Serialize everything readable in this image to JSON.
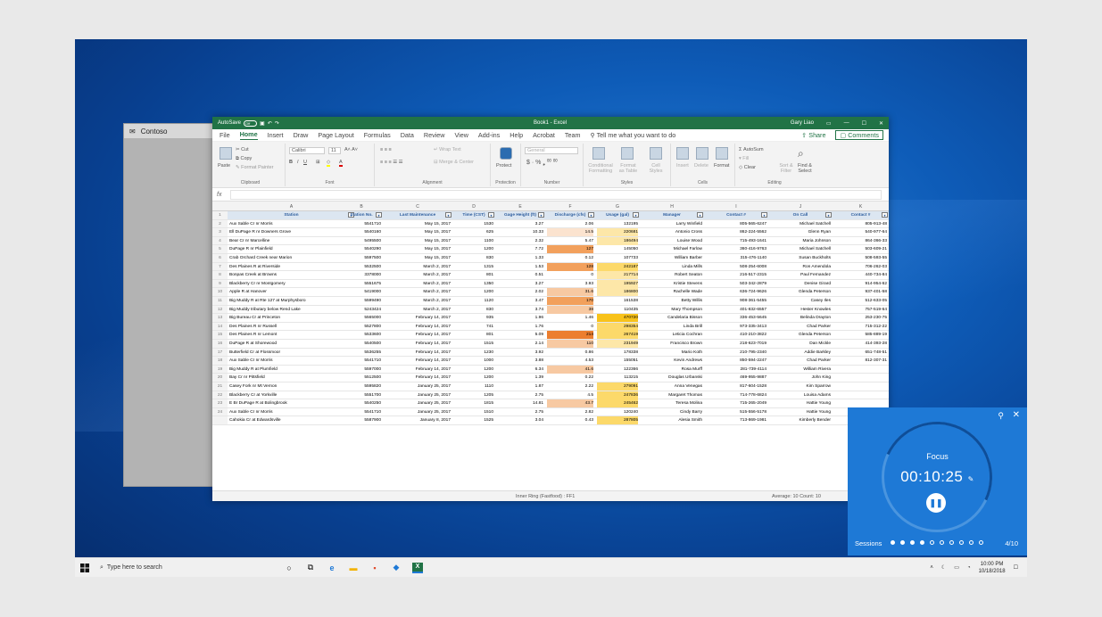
{
  "excel": {
    "autosave": "AutoSave",
    "autosave_state": "Off",
    "title": "Book1 - Excel",
    "user": "Gary Liao",
    "menu": [
      "File",
      "Home",
      "Insert",
      "Draw",
      "Page Layout",
      "Formulas",
      "Data",
      "Review",
      "View",
      "Add-ins",
      "Help",
      "Acrobat",
      "Team"
    ],
    "tell_me": "Tell me what you want to do",
    "share": "Share",
    "comments": "Comments",
    "ribbon": {
      "cut": "Cut",
      "copy": "Copy",
      "format_painter": "Format Painter",
      "paste": "Paste",
      "clipboard": "Clipboard",
      "font_name": "Calibri",
      "font_size": "11",
      "font": "Font",
      "wrap": "Wrap Text",
      "merge": "Merge & Center",
      "alignment": "Alignment",
      "protect": "Protect",
      "protection": "Protection",
      "number_format": "General",
      "number": "Number",
      "cond": "Conditional Formatting",
      "format_table": "Format as Table",
      "cell_styles": "Cell Styles",
      "styles": "Styles",
      "insert": "Insert",
      "delete": "Delete",
      "format": "Format",
      "cells": "Cells",
      "autosum": "AutoSum",
      "fill": "Fill",
      "clear": "Clear",
      "sort": "Sort & Filter",
      "find": "Find & Select",
      "editing": "Editing"
    },
    "fx": "fx",
    "columns": [
      "A",
      "B",
      "C",
      "D",
      "E",
      "F",
      "G",
      "H",
      "I",
      "J",
      "K"
    ],
    "headers": [
      "Station",
      "Station No.",
      "Last Maintenance",
      "Time (CST)",
      "Gage Height (ft)",
      "Discharge (cfs)",
      "Usage (gal)",
      "Manager",
      "Contact #",
      "On Call",
      "Contact #"
    ],
    "rows": [
      [
        "Aux Sable Cr nr Morris",
        "5541710",
        "May 15, 2017",
        "1530",
        "3.27",
        "2.06",
        "132195",
        "Larry Winfield",
        "805-565-6247",
        "Michael Satchell",
        "805-913-48"
      ],
      [
        "Ell DuPage R nr Downers Grove",
        "5540160",
        "May 15, 2017",
        "625",
        "10.33",
        "14.5",
        "220681",
        "Antonio Cross",
        "862-224-5562",
        "Glenn Ryan",
        "540-977-64"
      ],
      [
        "Bear Cr nr Marcelline",
        "5495500",
        "May 15, 2017",
        "1100",
        "2.32",
        "5.47",
        "186494",
        "Louise Wood",
        "715-493-1641",
        "Maria Johnson",
        "864-366-33"
      ],
      [
        "DuPage R nr Plainfield",
        "5540290",
        "May 15, 2017",
        "1200",
        "7.72",
        "127",
        "145050",
        "Michael Farlow",
        "360-416-9763",
        "Michael Satchell",
        "503-609-21"
      ],
      [
        "Crab Orchard Creek near Marion",
        "5597500",
        "May 15, 2017",
        "830",
        "1.33",
        "0.12",
        "107733",
        "William Barber",
        "315-476-1140",
        "Susan Buckholts",
        "508-593-55"
      ],
      [
        "Des Plaines R at Riverside",
        "5532500",
        "March 2, 2017",
        "1315",
        "1.53",
        "128",
        "242187",
        "Linda Mills",
        "508-254-6008",
        "Ron Amendola",
        "706-262-03"
      ],
      [
        "Bonpas Creek at Browns",
        "3378000",
        "March 2, 2017",
        "801",
        "0.51",
        "0",
        "217714",
        "Robert Seaton",
        "216-517-2315",
        "Paul Fernandez",
        "440-734-84"
      ],
      [
        "Blackberry Cr nr Montgomery",
        "5551675",
        "March 2, 2017",
        "1350",
        "3.27",
        "3.93",
        "195927",
        "Kristie Stevens",
        "503-342-2879",
        "Denise Girard",
        "914-954-62"
      ],
      [
        "Apple R at Hanover",
        "5419000",
        "March 2, 2017",
        "1200",
        "2.02",
        "31.6",
        "186800",
        "Rachelle Wade",
        "636-724-9626",
        "Glenda Peterson",
        "937-401-58"
      ],
      [
        "Big Muddy R at Rte 127 at Murphysboro",
        "5599490",
        "March 2, 2017",
        "1120",
        "3.47",
        "170",
        "161538",
        "Betty Willis",
        "908-361-5455",
        "Casey Iles",
        "512-633-05"
      ],
      [
        "Big Muddy tributary below Rend Lake",
        "5243424",
        "March 2, 2017",
        "830",
        "3.74",
        "38",
        "110435",
        "Mary Thompson",
        "401-832-6557",
        "Hester Knowles",
        "757-519-64"
      ],
      [
        "Big Bureau Cr at Princeton",
        "5565000",
        "February 14, 2017",
        "935",
        "1.96",
        "1.46",
        "470720",
        "Candelaria Bisson",
        "336-453-5645",
        "Belinda Drayton",
        "253-230-75"
      ],
      [
        "Des Plaines R nr Russell",
        "5527800",
        "February 14, 2017",
        "741",
        "1.76",
        "0",
        "298354",
        "Linda Brill",
        "973-335-3413",
        "Chad Parker",
        "715-312-22"
      ],
      [
        "Des Plaines R nr Lemont",
        "5533600",
        "February 14, 2017",
        "801",
        "5.09",
        "214",
        "267419",
        "Leticia Cochran",
        "410-210-3822",
        "Glenda Peterson",
        "585-889-19"
      ],
      [
        "DuPage R at Shorewood",
        "5540500",
        "February 14, 2017",
        "1515",
        "2.14",
        "110",
        "231949",
        "Francisco Brown",
        "218-623-7019",
        "Dan Mickle",
        "414-393-28"
      ],
      [
        "Butterfield Cr at Flossmoor",
        "5536255",
        "February 14, 2017",
        "1230",
        "3.92",
        "0.86",
        "178338",
        "Mario Koth",
        "210-795-2340",
        "Addie Barkley",
        "651-748-51"
      ],
      [
        "Aux Sable Cr nr Morris",
        "5541710",
        "February 14, 2017",
        "1000",
        "3.88",
        "4.53",
        "155051",
        "Kevin Andrews",
        "850-594-2247",
        "Chad Parker",
        "812-307-31"
      ],
      [
        "Big Muddy R at Plumfield",
        "5597000",
        "February 14, 2017",
        "1200",
        "6.34",
        "41.6",
        "122366",
        "Rosa Murff",
        "281-739-4114",
        "William Rivera",
        ""
      ],
      [
        "Bay Cr nr Pittsfield",
        "5512500",
        "February 14, 2017",
        "1200",
        "1.39",
        "0.22",
        "113215",
        "Douglas Urbanski",
        "469-955-9887",
        "John King",
        ""
      ],
      [
        "Casey Fork nr Mt Vernon",
        "5595820",
        "January 25, 2017",
        "1110",
        "1.87",
        "2.22",
        "279091",
        "Anna Venegas",
        "817-604-1528",
        "Kim Sparrow",
        ""
      ],
      [
        "Blackberry Cr at Yorkville",
        "5551700",
        "January 25, 2017",
        "1205",
        "2.75",
        "4.5",
        "247836",
        "Margaret Thomas",
        "714-778-6824",
        "Louisa Adams",
        ""
      ],
      [
        "E Br DuPage R at Bolingbrook",
        "5540250",
        "January 25, 2017",
        "1815",
        "14.81",
        "43.7",
        "245462",
        "Teresa Molina",
        "715-265-2049",
        "Hattie Young",
        ""
      ],
      [
        "Aux Sable Cr nr Morris",
        "5541710",
        "January 25, 2017",
        "1510",
        "2.75",
        "2.82",
        "120240",
        "Cindy Barry",
        "515-556-5178",
        "Hattie Young",
        ""
      ],
      [
        "Cahokia Cr at Edwardsville",
        "5587900",
        "January 8, 2017",
        "1525",
        "3.04",
        "0.43",
        "287805",
        "Alesia Smith",
        "713-869-1981",
        "Kimberly Bender",
        ""
      ]
    ],
    "status_center": "Inner Ring (Fastfood) : FF1",
    "status_right": "Average: 10    Count: 10"
  },
  "contoso": {
    "title": "Contoso"
  },
  "focus": {
    "label": "Focus",
    "time": "00:10:25",
    "sessions": "Sessions",
    "count": "4/10",
    "filled": 4,
    "total": 10
  },
  "taskbar": {
    "search": "Type here to search",
    "time": "10:00 PM",
    "date": "10/18/2018"
  },
  "colors": {
    "excel_green": "#217346",
    "header_blue": "#dce6f1",
    "focus_blue": "#1e79d6"
  }
}
